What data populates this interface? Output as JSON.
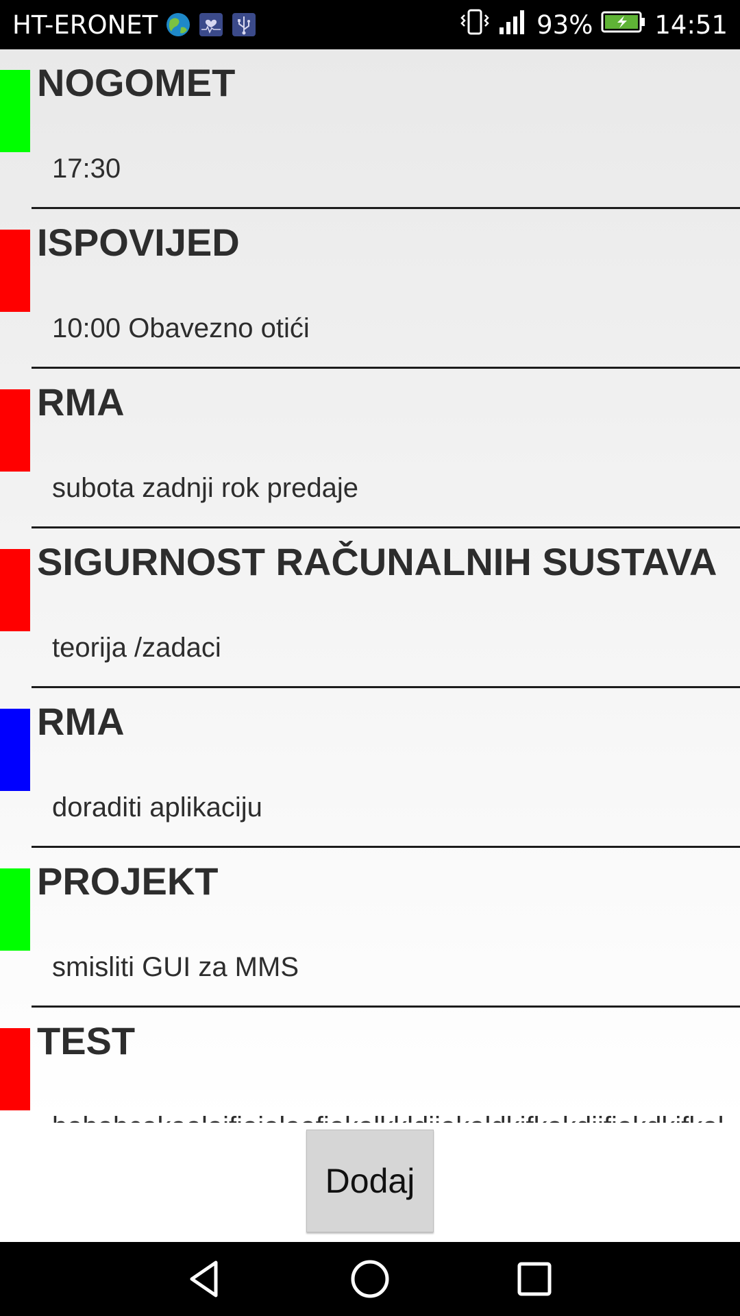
{
  "status_bar": {
    "carrier": "HT-ERONET",
    "battery_percent": "93%",
    "time": "14:51",
    "notification_icons": [
      "globe-icon",
      "health-monitor-icon",
      "usb-icon"
    ],
    "system_icons": [
      "vibrate-icon",
      "signal-icon",
      "battery-charging-icon"
    ]
  },
  "events": [
    {
      "title": "NOGOMET",
      "description": "17:30",
      "color": "#00ff00"
    },
    {
      "title": "ISPOVIJED",
      "description": "10:00 Obavezno otići",
      "color": "#ff0000"
    },
    {
      "title": "RMA",
      "description": "subota zadnji rok predaje",
      "color": "#ff0000"
    },
    {
      "title": "SIGURNOST RAČUNALNIH SUSTAVA",
      "description": "teorija /zadaci",
      "color": "#ff0000"
    },
    {
      "title": "RMA",
      "description": "doraditi aplikaciju",
      "color": "#0000ff"
    },
    {
      "title": "PROJEKT",
      "description": "smisliti GUI za MMS",
      "color": "#00ff00"
    },
    {
      "title": "TEST",
      "description": "bababcakaalaifiaialaafiakalkkldiiakaldkifkakdiifiakdkifkaldi",
      "color": "#ff0000"
    }
  ],
  "add_button_label": "Dodaj",
  "nav_bar": [
    "back-icon",
    "home-icon",
    "recents-icon"
  ]
}
